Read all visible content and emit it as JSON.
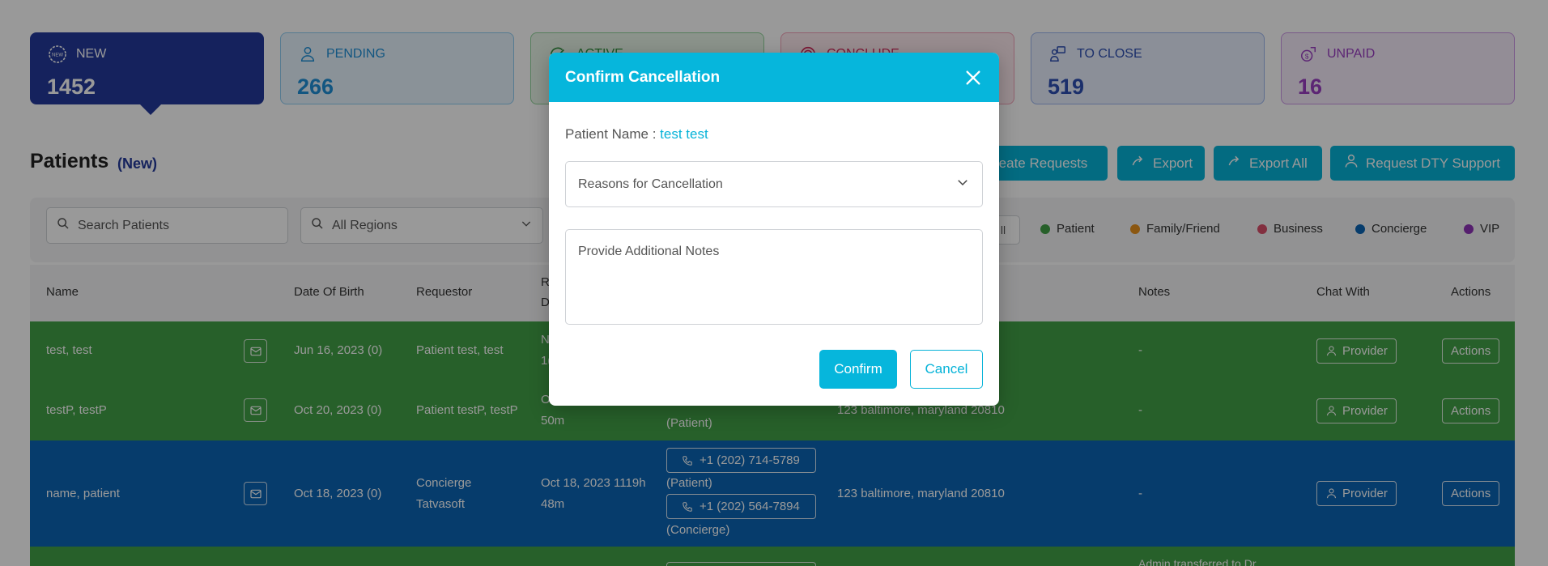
{
  "cards": [
    {
      "key": "new",
      "label": "NEW",
      "count": "1452",
      "icon": "new-badge-icon"
    },
    {
      "key": "pending",
      "label": "PENDING",
      "count": "266",
      "icon": "person-icon"
    },
    {
      "key": "active",
      "label": "ACTIVE",
      "count": "",
      "icon": "check-icon"
    },
    {
      "key": "conclude",
      "label": "CONCLUDE",
      "count": "",
      "icon": "target-icon"
    },
    {
      "key": "toclose",
      "label": "TO CLOSE",
      "count": "519",
      "icon": "close-case-icon"
    },
    {
      "key": "unpaid",
      "label": "UNPAID",
      "count": "16",
      "icon": "money-icon"
    }
  ],
  "page": {
    "title": "Patients",
    "subtitle": "(New)"
  },
  "toolbar": {
    "create_requests": "reate Requests",
    "export": "Export",
    "export_all": "Export All",
    "request_support": "Request DTY Support"
  },
  "filters": {
    "search_placeholder": "Search Patients",
    "region": "All Regions",
    "all_label": "ll"
  },
  "legend": [
    {
      "label": "Patient",
      "color": "#42a046"
    },
    {
      "label": "Family/Friend",
      "color": "#e8911d"
    },
    {
      "label": "Business",
      "color": "#d94f6a"
    },
    {
      "label": "Concierge",
      "color": "#0a64b4"
    },
    {
      "label": "VIP",
      "color": "#8e33b8"
    }
  ],
  "table": {
    "headers": {
      "name": "Name",
      "dob": "Date Of Birth",
      "requestor": "Requestor",
      "req_date_top": "R",
      "req_date_bottom": "D",
      "notes": "Notes",
      "chat": "Chat With",
      "actions": "Actions"
    },
    "rows": [
      {
        "name": "test, test",
        "dob": "Jun 16, 2023 (0)",
        "requestor": "Patient test, test",
        "date_top": "N",
        "date_bottom": "1(",
        "notes": "-",
        "chat": "Provider",
        "actions": "Actions"
      },
      {
        "name": "testP, testP",
        "dob": "Oct 20, 2023 (0)",
        "requestor": "Patient testP, testP",
        "date_top": "O",
        "date_bottom": "50m",
        "phone_type": "(Patient)",
        "address": "123 baltimore, maryland 20810",
        "notes": "-",
        "chat": "Provider",
        "actions": "Actions"
      },
      {
        "name": "name, patient",
        "dob": "Oct 18, 2023 (0)",
        "requestor_top": "Concierge",
        "requestor_bottom": "Tatvasoft",
        "date_top": "Oct 18, 2023 1119h",
        "date_bottom": "48m",
        "phone1": "+1 (202) 714-5789",
        "phone1_type": "(Patient)",
        "phone2": "+1 (202) 564-7894",
        "phone2_type": "(Concierge)",
        "address": "123 baltimore, maryland 20810",
        "notes": "-",
        "chat": "Provider",
        "actions": "Actions"
      },
      {
        "notes_partial": "Admin transferred to Dr."
      }
    ]
  },
  "modal": {
    "title": "Confirm Cancellation",
    "patient_label": "Patient Name : ",
    "patient_value": "test test",
    "reason_placeholder": "Reasons for Cancellation",
    "notes_placeholder": "Provide Additional Notes",
    "confirm": "Confirm",
    "cancel": "Cancel"
  }
}
